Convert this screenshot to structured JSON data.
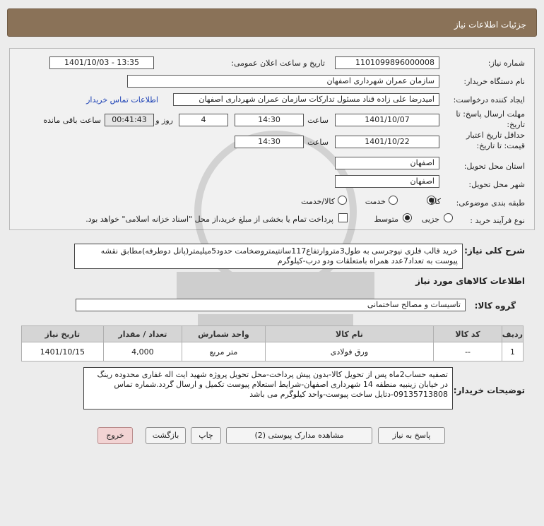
{
  "header": {
    "title": "جزئیات اطلاعات نیاز"
  },
  "form": {
    "need_number_label": "شماره نیاز:",
    "need_number": "1101099896000008",
    "announce_label": "تاریخ و ساعت اعلان عمومی:",
    "announce_value": "1401/10/03 - 13:35",
    "buyer_org_label": "نام دستگاه خریدار:",
    "buyer_org": "سازمان عمران شهرداری اصفهان",
    "creator_label": "ایجاد کننده درخواست:",
    "creator": "امیدرضا علی زاده قناد مسئول تدارکات سازمان عمران شهرداری اصفهان",
    "contact_link": "اطلاعات تماس خریدار",
    "deadline_label_1": "مهلت ارسال پاسخ: تا",
    "deadline_label_2": "تاریخ:",
    "deadline_date": "1401/10/07",
    "time_label": "ساعت",
    "deadline_time": "14:30",
    "days_value": "4",
    "days_label": "روز و",
    "remaining_value": "00:41:43",
    "remaining_label": "ساعت باقی مانده",
    "validity_label_1": "حداقل تاریخ اعتبار",
    "validity_label_2": "قیمت: تا تاریخ:",
    "validity_date": "1401/10/22",
    "validity_time": "14:30",
    "province_label": "استان محل تحویل:",
    "province": "اصفهان",
    "city_label": "شهر محل تحویل:",
    "city": "اصفهان",
    "category_label": "طبقه بندی موضوعی:",
    "category_options": [
      "کالا",
      "خدمت",
      "کالا/خدمت"
    ],
    "category_selected": "کالا",
    "process_label": "نوع فرآیند خرید :",
    "process_options": [
      "جزیی",
      "متوسط"
    ],
    "process_selected": "متوسط",
    "treasury_note": "پرداخت تمام یا بخشی از مبلغ خرید،از محل \"اسناد خزانه اسلامی\" خواهد بود."
  },
  "description": {
    "label": "شرح کلی نیاز:",
    "text": "خرید قالب فلزی نیوجرسی به طول3متروارتفاع117سانتیمتروضخامت حدود5میلیمتر(پانل دوطرفه)مطابق نقشه پیوست به تعداد7عدد همراه بامتعلقات ودو درب-کیلوگرم"
  },
  "goods": {
    "section_title": "اطلاعات کالاهای مورد نیاز",
    "group_label": "گروه کالا:",
    "group_value": "تاسیسات و مصالح ساختمانی",
    "columns": [
      "ردیف",
      "کد کالا",
      "نام کالا",
      "واحد شمارش",
      "تعداد / مقدار",
      "تاریخ نیاز"
    ],
    "rows": [
      {
        "row": "1",
        "code": "--",
        "name": "ورق فولادی",
        "unit": "متر مربع",
        "qty": "4,000",
        "date": "1401/10/15"
      }
    ]
  },
  "buyer_notes": {
    "label": "توضیحات خریدار:",
    "text": "تصفیه حساب2ماه پس از تحویل کالا-بدون پیش پرداخت-محل تحویل پروژه شهید ایت اله غفاری محدوده رینگ در خیابان زینبیه منطقه 14 شهرداری اصفهان-شرایط استعلام پیوست تکمیل و ارسال گردد.شماره تماس 09135713808-دتایل ساخت پیوست-واحد کیلوگرم می باشد"
  },
  "buttons": {
    "reply": "پاسخ به نیاز",
    "view_docs": "مشاهده مدارک پیوستی (2)",
    "print": "چاپ",
    "back": "بازگشت",
    "exit": "خروج"
  },
  "colors": {
    "header_bg": "#8a7258",
    "link": "#1a3fb4",
    "exit_bg": "#f2d3d3"
  }
}
